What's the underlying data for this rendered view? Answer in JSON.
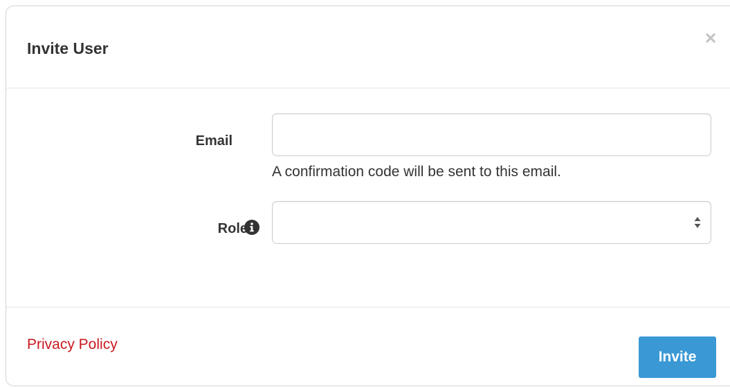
{
  "modal": {
    "title": "Invite User"
  },
  "form": {
    "email_label": "Email",
    "email_value": "",
    "email_placeholder": "",
    "email_help": "A confirmation code will be sent to this email.",
    "role_label": "Role",
    "role_value": ""
  },
  "footer": {
    "privacy_link": "Privacy Policy",
    "invite_label": "Invite"
  },
  "icons": {
    "close": "close-icon",
    "info": "info-icon",
    "select": "select-arrows-icon"
  },
  "colors": {
    "primary_button": "#3a98d4",
    "link": "#c9191e",
    "text": "#333333",
    "border": "#cccccc"
  }
}
